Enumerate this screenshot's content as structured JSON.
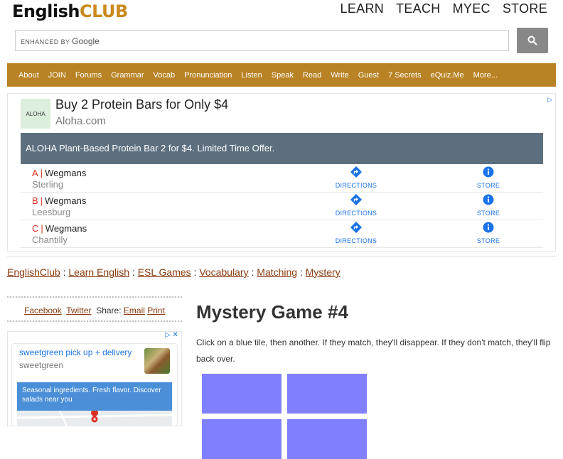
{
  "header": {
    "logo_english": "English",
    "logo_club": "CLUB",
    "nav": [
      "LEARN",
      "TEACH",
      "MYEC",
      "STORE"
    ],
    "search_brand_prefix": "ENHANCED BY",
    "search_brand": "Google",
    "search_icon": "search-icon"
  },
  "menu": [
    "About",
    "JOIN",
    "Forums",
    "Grammar",
    "Vocab",
    "Pronunciation",
    "Listen",
    "Speak",
    "Read",
    "Write",
    "Guest",
    "7 Secrets",
    "eQuiz.Me",
    "More..."
  ],
  "ad": {
    "logo_text": "ALOHA",
    "headline": "Buy 2 Protein Bars for Only $4",
    "domain": "Aloha.com",
    "banner": "ALOHA Plant-Based Protein Bar 2 for $4. Limited Time Offer.",
    "directions_label": "DIRECTIONS",
    "store_label": "STORE",
    "locations": [
      {
        "letter": "A",
        "name": "Wegmans",
        "city": "Sterling"
      },
      {
        "letter": "B",
        "name": "Wegmans",
        "city": "Leesburg"
      },
      {
        "letter": "C",
        "name": "Wegmans",
        "city": "Chantilly"
      }
    ]
  },
  "breadcrumb": [
    "EnglishClub",
    "Learn English",
    "ESL Games",
    "Vocabulary",
    "Matching",
    "Mystery"
  ],
  "breadcrumb_sep": ":",
  "share": {
    "facebook": "Facebook",
    "twitter": "Twitter",
    "share_label": "Share:",
    "email": "Email",
    "print": "Print"
  },
  "side_ad": {
    "title": "sweetgreen pick up + delivery",
    "subtitle": "sweetgreen",
    "banner": "Seasonal ingredients. Fresh flavor. Discover salads near you"
  },
  "main": {
    "title": "Mystery Game #4",
    "instructions": "Click on a blue tile, then another. If they match, they'll disappear. If they don't match, they'll flip back over."
  },
  "colors": {
    "menu_bar": "#b98325",
    "tile": "#8080ff",
    "link": "#8b3a0e",
    "logo_club": "#c98a1c"
  }
}
